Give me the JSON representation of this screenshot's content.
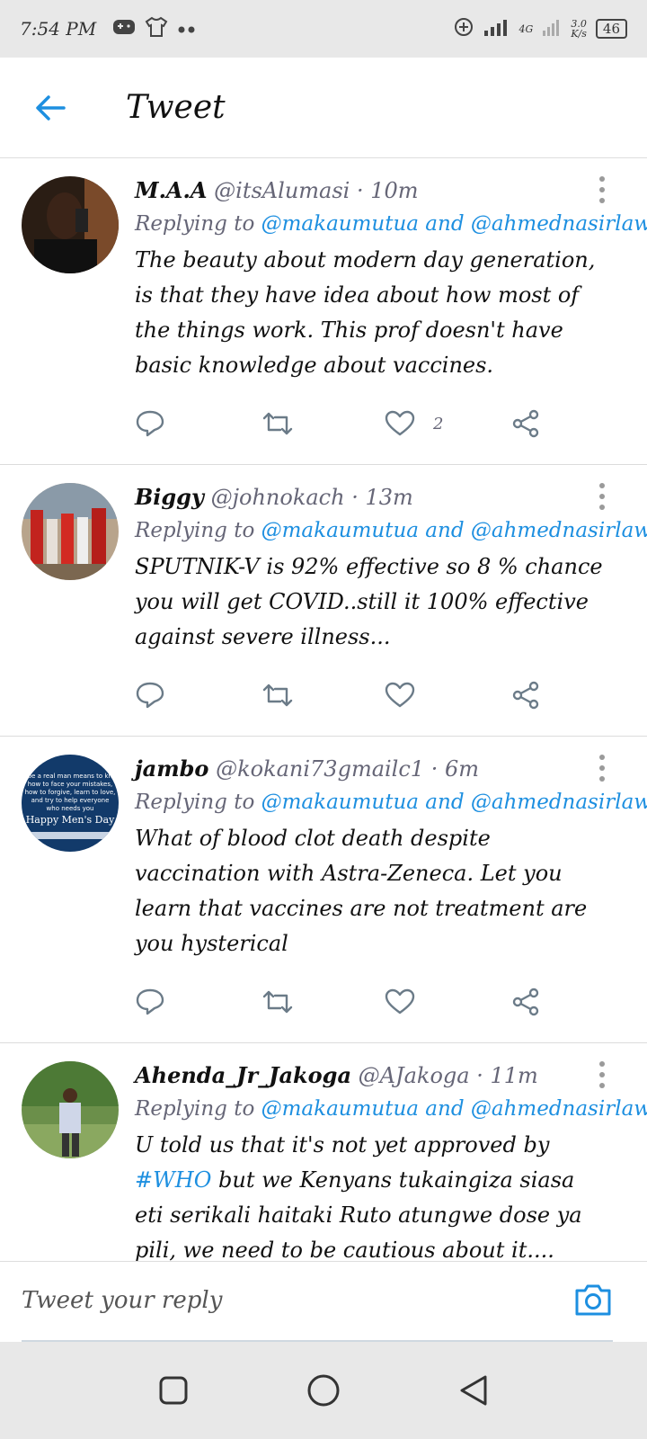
{
  "status_bar": {
    "time": "7:54 PM",
    "network": "4G",
    "speed_top": "3.0",
    "speed_bottom": "K/s",
    "battery": "46"
  },
  "header": {
    "title": "Tweet"
  },
  "tweets": [
    {
      "name": "M.A.A",
      "handle": "@itsAlumasi",
      "time": "10m",
      "replying_prefix": "Replying to",
      "mention1": "@makaumutua",
      "and": "and",
      "mention2": "@ahmednasirlaw",
      "text": "The beauty about modern day generation, is that they have idea about how most of the things work. This prof doesn't have basic knowledge about vaccines.",
      "likes": "2"
    },
    {
      "name": "Biggy",
      "handle": "@johnokach",
      "time": "13m",
      "replying_prefix": "Replying to",
      "mention1": "@makaumutua",
      "and": "and",
      "mention2": "@ahmednasirlaw",
      "text": "SPUTNIK-V is 92% effective so 8 % chance you will get COVID..still it 100% effective against severe illness...",
      "likes": ""
    },
    {
      "name": "jambo",
      "handle": "@kokani73gmailc1",
      "time": "6m",
      "replying_prefix": "Replying to",
      "mention1": "@makaumutua",
      "and": "and",
      "mention2": "@ahmednasirlaw",
      "text": "What of blood clot death despite vaccination with Astra-Zeneca. Let you learn that vaccines are not treatment are you hysterical",
      "likes": "",
      "avatar_text_1": "To be a real man means to know",
      "avatar_text_2": "how to face your mistakes,",
      "avatar_text_3": "how to forgive, learn to love,",
      "avatar_text_4": "and try to help everyone",
      "avatar_text_5": "who needs you",
      "avatar_banner": "Happy Men's Day"
    },
    {
      "name": "Ahenda_Jr_Jakoga",
      "handle": "@AJakoga",
      "time": "11m",
      "replying_prefix": "Replying to",
      "mention1": "@makaumutua",
      "and": "and",
      "mention2": "@ahmednasirlaw",
      "text_before": "U told us that it's not yet approved by",
      "hashtag": "#WHO",
      "text_after": "but we Kenyans tukaingiza siasa eti serikali haitaki Ruto atungwe dose ya pili, we need to be cautious about it....",
      "likes": ""
    }
  ],
  "composer": {
    "placeholder": "Tweet your reply"
  },
  "colors": {
    "accent": "#1d8fe0",
    "muted": "#667788",
    "divider": "#dcdcdc"
  }
}
